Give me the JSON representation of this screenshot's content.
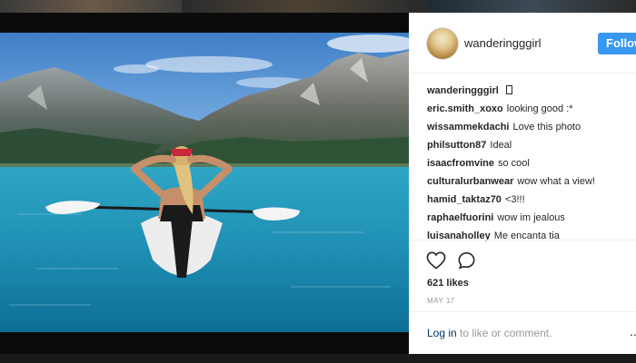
{
  "post": {
    "author": "wanderingggirl",
    "follow_label": "Follow",
    "caption_user": "wanderingggirl",
    "likes_text": "621 likes",
    "date_text": "MAY 17",
    "login_link": "Log in",
    "login_suffix": " to like or comment.",
    "more_label": "..."
  },
  "comments": [
    {
      "user": "eric.smith_xoxo",
      "text": "looking good :*"
    },
    {
      "user": "wissammekdachi",
      "text": "Love this photo"
    },
    {
      "user": "philsutton87",
      "text": "Ideal"
    },
    {
      "user": "isaacfromvine",
      "text": "so cool"
    },
    {
      "user": "culturalurbanwear",
      "text": "wow what a view!"
    },
    {
      "user": "hamid_taktaz70",
      "text": "<3!!!"
    },
    {
      "user": "raphaelfuorini",
      "text": "wow im jealous"
    },
    {
      "user": "luisanaholley",
      "text": "Me encanta tia"
    }
  ],
  "icons": {
    "like": "heart-icon",
    "comment": "comment-bubble-icon"
  },
  "colors": {
    "follow_button": "#3897f0",
    "link": "#003569",
    "text": "#262626",
    "muted": "#999999"
  }
}
